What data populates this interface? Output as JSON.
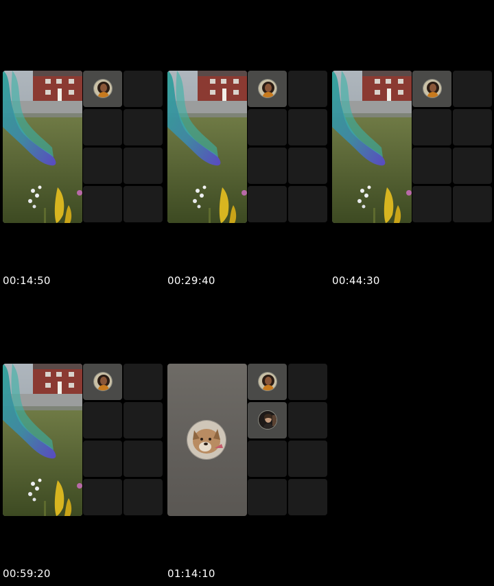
{
  "thumbnails": [
    {
      "timestamp": "00:14:50",
      "scene": "smoke-video"
    },
    {
      "timestamp": "00:29:40",
      "scene": "smoke-video"
    },
    {
      "timestamp": "00:44:30",
      "scene": "smoke-video"
    },
    {
      "timestamp": "00:59:20",
      "scene": "smoke-video"
    },
    {
      "timestamp": "01:14:10",
      "scene": "dog-avatar-video"
    }
  ],
  "colors": {
    "background": "#000000",
    "tile_empty": "#1c1c1c",
    "tile_active": "#4a4a48",
    "timestamp_text": "#ffffff"
  },
  "icons": [
    "participant-avatar-icon",
    "dog-avatar-icon"
  ]
}
